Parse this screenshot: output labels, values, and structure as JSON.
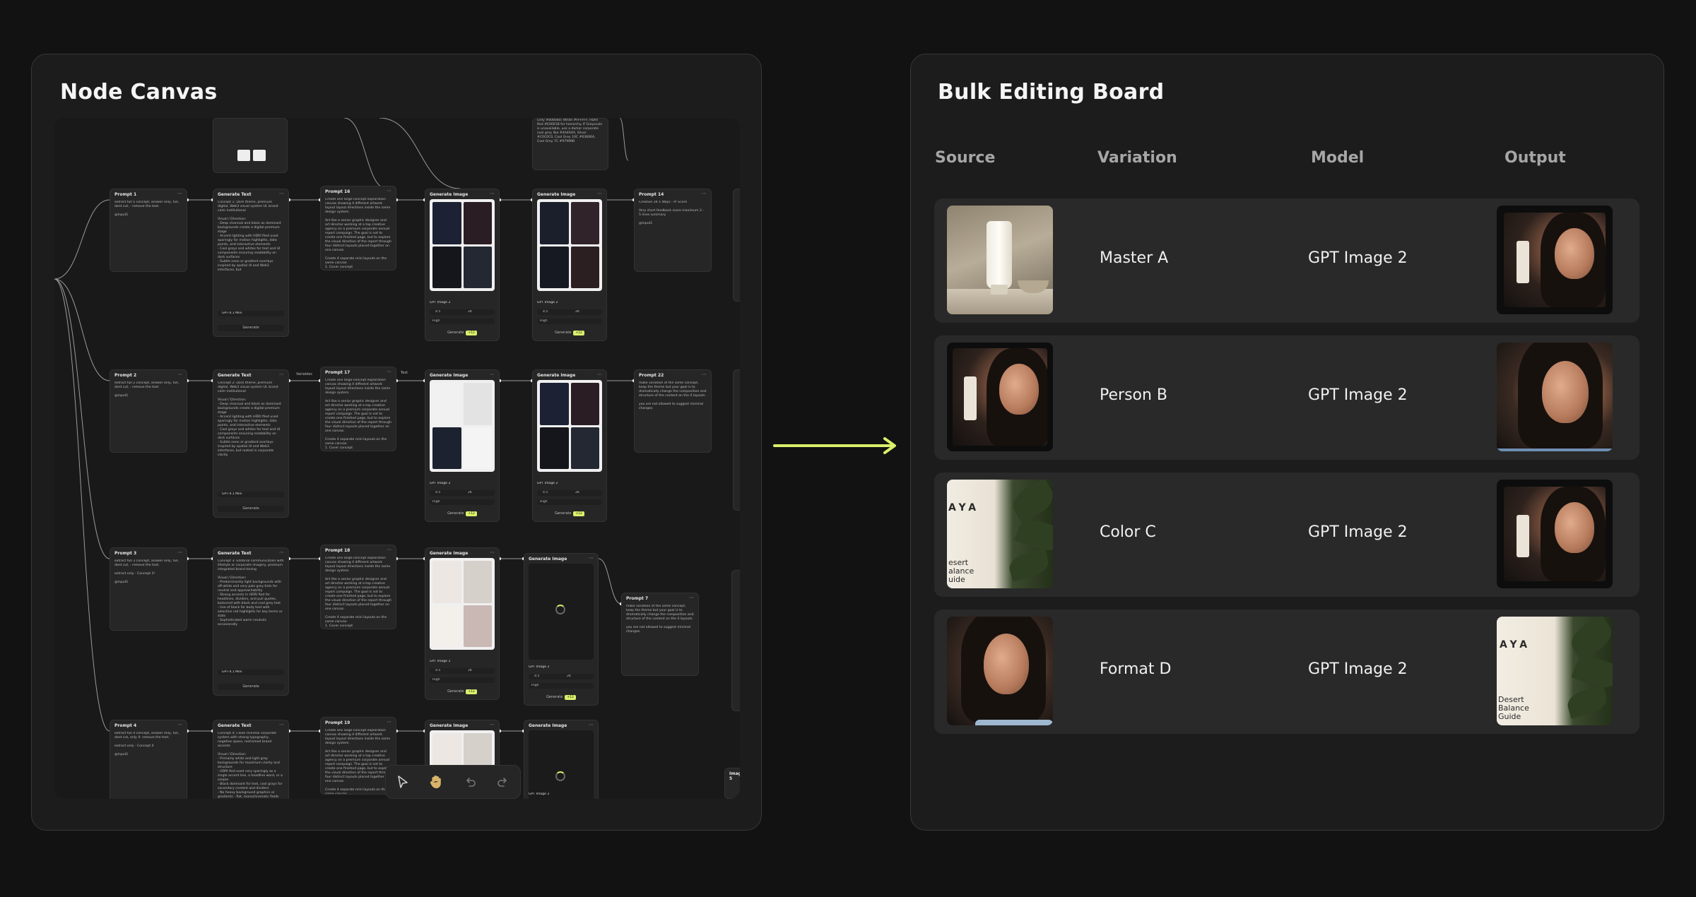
{
  "panels": {
    "node_canvas_title": "Node Canvas",
    "bulk_board_title": "Bulk Editing Board"
  },
  "canvas": {
    "prompts": [
      {
        "title": "Prompt 1",
        "text": "extract full 5 concept, answer only, full, dont cut, - remove the text.\n\n@input1"
      },
      {
        "title": "Prompt 2",
        "text": "extract full 2 concept, answer only, full, dont cut, - remove the text.\n\n@input1"
      },
      {
        "title": "Prompt 3",
        "text": "extract full 3 concept, answer only, full, dont cut, - remove the text.\n\nextract only - Concept 3!\n\n@input1"
      },
      {
        "title": "Prompt 4",
        "text": "extract full 4 concept, answer only, full, dont cut, only 4- remove the text.\n\nextract only - Concept 4\n\n@input1"
      }
    ],
    "generate_text": {
      "title": "Generate Text",
      "model": "GPT-4.1 Mini",
      "button": "Generate",
      "texts": [
        "Concept 1: Dark theme, premium digital, Web3 visual system UI, brand calm institutional\n\nVisual / Direction:\n- Deep charcoal and black as dominant backgrounds create a digital premium stage\n- Accent lighting with HDRI filed used sparingly for motion highlights, data points, and interactive elements\n- Cool greys and whites for text and UI components ensuring readability on dark surfaces\n- Subtle neon or gradient overlays inspired by spatial UI and Web3 interfaces, but",
        "Concept 2: Dark theme, premium digital, Web3 visual system UI, brand calm institutional\n\nVisual / Direction:\n- Deep charcoal and black as dominant backgrounds create a digital premium stage\n- Accent lighting with HDRI filed used sparingly for motion highlights, data points, and interactive elements\n- Cool greys and whites for text and UI components ensuring readability on dark surfaces\n- Subtle neon or gradient overlays inspired by spatial UI and Web3 interfaces, but rooted in corporate clarity",
        "Concept 3: Editorial communication with lifestyle or corporate imagery, premium integrated brand toning\n\nVisual / Direction:\n- Predominantly light backgrounds with off-white and very pale grey tints for neutral and approachability\n- Strong accents in HDRI Red for headlines, dividers, and pull quotes, balanced with black and cool grey text\n- Use of black for body text with selective red highlights for key terms or stats\n- Sophisticated warm neutrals occasionally",
        "Concept 4: Clean minimal corporate system with strong typography, negative space, restrained brand accents\n\nVisual / Direction:\n- Primarily white and light gray backgrounds for maximum clarity and structure\n- HDRI Red used very sparingly as a single accent line, a headline word, or a simple\n- Black dominant for text, cool grays for secondary content and dividers\n- No heavy background graphics or gradients - flat, monochromatic fields for quick communication"
      ]
    },
    "prompt_mid": {
      "titles": [
        "Prompt 16",
        "Prompt 17",
        "Prompt 18",
        "Prompt 19"
      ],
      "text": "Create one large-concept exploration canvas showing 4 different artwork layout layout directions inside the same design system.\n\nAct like a senior graphic designer and art director working at a top creative agency on a premium corporate annual report campaign. The goal is not to create one finished page, but to explore the visual direction of the report through four distinct layouts placed together on one canvas.\n\nCreate 4 separate mini layouts on the same canvas:\n1. Cover concept"
    },
    "generate_image": {
      "title": "Generate Image",
      "model": "GPT Image 2",
      "ratio": "4:5",
      "count": "2K",
      "quality": "High",
      "button": "Generate",
      "pill": "+12"
    },
    "prompt_right": [
      {
        "title": "Prompt 14",
        "text": "Creative 2K 5 Ways - Pr Score\n\nVery short feedback score maximum 3 - 5 lines summary\n\n@input1"
      },
      {
        "title": "Prompt 22",
        "text": "make variation of the same concept, keep the theme but your goal is to dramatically change the composition and structure of the content on the 4 layouts.\n\nyou are not allowed to suggest minimal changes."
      },
      {
        "title": "Prompt 7",
        "text": "make variation of the same concept, keep the theme but your goal is to dramatically change the composition and structure of the content on the 4 layouts.\n\nyou are not allowed to suggest minimal changes."
      }
    ],
    "top_note": "Colors: #000000, #1A1A1A, #2E2E2E, Grey #808080; White #FFFFFF; HDRI Red #E0001B for hierarchy. If Greyscale is unavailable, use a darker corporate cool grey like #4A4A4A, Silver #C0C0C0, Cool Grey 10C #63666A, Cool Grey 7C #97999B",
    "edge_labels": [
      "Variables",
      "Text"
    ],
    "side_label": "Image 5"
  },
  "bulk_board": {
    "columns": [
      "Source",
      "Variation",
      "Model",
      "Output"
    ],
    "rows": [
      {
        "variation": "Master A",
        "model": "GPT Image 2"
      },
      {
        "variation": "Person B",
        "model": "GPT Image 2"
      },
      {
        "variation": "Color C",
        "model": "GPT Image 2"
      },
      {
        "variation": "Format D",
        "model": "GPT Image 2"
      }
    ],
    "brand": {
      "name": "AYA",
      "tagline": "Desert\nBalance\nGuide",
      "tagline_cropped": "esert\nalance\nuide"
    }
  },
  "colors": {
    "accent": "#D9F06A",
    "background": "#121212",
    "panel": "#1C1C1C",
    "row": "#292929"
  },
  "icons": {
    "toolbar": [
      "cursor-icon",
      "hand-icon",
      "undo-icon",
      "redo-icon"
    ],
    "flow": "arrow-right-icon"
  }
}
